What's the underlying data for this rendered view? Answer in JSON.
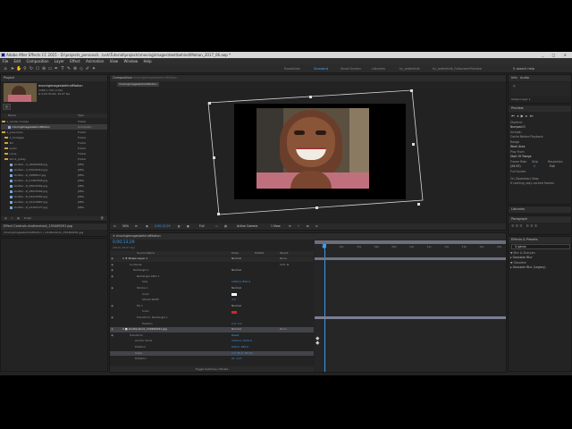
{
  "window": {
    "title": "Adobe After Effects CC 2015 - D:\\projects_personal\\...\\vck\\Tutorial\\projects\\moving\\images\\text\\behind\\Motion_2017_06.aep *",
    "controls": "_ □ ✕"
  },
  "menu": [
    "File",
    "Edit",
    "Composition",
    "Layer",
    "Effect",
    "Animation",
    "View",
    "Window",
    "Help"
  ],
  "workspaces": [
    "Essentials",
    "Standard",
    "Small Screen",
    "Libraries",
    "ky_watchfolk",
    "ky_watchfolk_fullscreenPreview"
  ],
  "active_workspace": "Standard",
  "search": {
    "label": "search help"
  },
  "project": {
    "tab": "Project",
    "comp_name": "movingimagesbehindMotion",
    "comp_info_1": "1280 x 720 (1.00)",
    "comp_info_2": "Δ 0;00;30;00, 29.97 fps",
    "col_name": "Name",
    "col_type": "Type",
    "items": [
      {
        "name": "1_render Comps",
        "type": "Folder",
        "kind": "folder",
        "selected": false
      },
      {
        "name": "movingimagesbehindMotion",
        "type": "Composit...",
        "kind": "comp",
        "selected": true
      },
      {
        "name": "2_precomps",
        "type": "Folder",
        "kind": "folder",
        "selected": false
      },
      {
        "name": "3_footages",
        "type": "Folder",
        "kind": "folder",
        "selected": false
      },
      {
        "name": "3D",
        "type": "Folder",
        "kind": "folder",
        "selected": false
      },
      {
        "name": "audio",
        "type": "Folder",
        "kind": "folder",
        "selected": false
      },
      {
        "name": "noise",
        "type": "Folder",
        "kind": "folder",
        "selected": false
      },
      {
        "name": "stock_pixlay",
        "type": "Folder",
        "kind": "folder",
        "selected": false
      },
      {
        "name": "shutter...4_18989848.jpg",
        "type": "JPEG",
        "kind": "jpg",
        "selected": false
      },
      {
        "name": "shutter...4_55618312.jpg",
        "type": "JPEG",
        "kind": "jpg",
        "selected": false
      },
      {
        "name": "shutter...6_2988812.jpg",
        "type": "JPEG",
        "kind": "jpg",
        "selected": false
      },
      {
        "name": "shutter...8_21987838.jpg",
        "type": "JPEG",
        "kind": "jpg",
        "selected": false
      },
      {
        "name": "shutter...8_28616584.jpg",
        "type": "JPEG",
        "kind": "jpg",
        "selected": false
      },
      {
        "name": "shutter...8_28618584.jpg",
        "type": "JPEG",
        "kind": "jpg",
        "selected": false
      },
      {
        "name": "shutter...8_29216584.jpg",
        "type": "JPEG",
        "kind": "jpg",
        "selected": false
      },
      {
        "name": "shutter...9_24119887.jpg",
        "type": "JPEG",
        "kind": "jpg",
        "selected": false
      },
      {
        "name": "shutter...9_24163127.jpg",
        "type": "JPEG",
        "kind": "jpg",
        "selected": false
      }
    ],
    "bpc": "8 bpc"
  },
  "effect_controls": {
    "tab": "Effect Controls shutterstock_150469291.jpg",
    "subtitle": "movingimagesbehindMotion • shutterstock_150469291.jpg"
  },
  "composition": {
    "tab": "Composition",
    "tab_name": "movingimagesbehindMotion",
    "crumb": "movingimagesbehindMotion",
    "zoom": "50%",
    "timecode": "0;00;13;29",
    "quality": "Full",
    "camera": "Active Camera",
    "view": "1 View"
  },
  "timeline": {
    "tab": "movingimagesbehindMotion",
    "timecode": "0;00;13;29",
    "frame_info": "00419 (29.97 fps)",
    "col_source": "Source Name",
    "col_mode": "Mode",
    "col_trkmat": "TrkMat",
    "col_parent": "Parent",
    "toggle_label": "Toggle Switches / Modes",
    "ruler": [
      "00s",
      "02s",
      "04s",
      "06s",
      "08s",
      "10s",
      "12s",
      "14s",
      "16s",
      "18s",
      "20s"
    ],
    "rows": [
      {
        "text": "1  ★ Shape Layer 1",
        "mode": "Normal",
        "parent": "None",
        "kind": "layer",
        "highlight": false
      },
      {
        "text": "Contents",
        "mode": "",
        "parent": "Add: ⊕",
        "kind": "group",
        "highlight": false
      },
      {
        "text": "Rectangle 1",
        "mode": "Normal",
        "parent": "",
        "kind": "prop",
        "highlight": false
      },
      {
        "text": "Rectangle Path 1",
        "mode": "",
        "parent": "",
        "kind": "prop",
        "highlight": false
      },
      {
        "text": "Size",
        "mode": "",
        "parent": "1904.0, 892.0",
        "kind": "value",
        "highlight": false
      },
      {
        "text": "Stroke 1",
        "mode": "Normal",
        "parent": "",
        "kind": "prop",
        "highlight": false
      },
      {
        "text": "Color",
        "mode": "",
        "parent": "",
        "kind": "swatch-white",
        "highlight": false
      },
      {
        "text": "Stroke Width",
        "mode": "",
        "parent": "4.0",
        "kind": "value",
        "highlight": false
      },
      {
        "text": "Fill 1",
        "mode": "Normal",
        "parent": "",
        "kind": "prop",
        "highlight": false
      },
      {
        "text": "Color",
        "mode": "",
        "parent": "",
        "kind": "swatch-red",
        "highlight": false
      },
      {
        "text": "Transform: Rectangle 1",
        "mode": "",
        "parent": "",
        "kind": "prop",
        "highlight": false
      },
      {
        "text": "Position",
        "mode": "",
        "parent": "0.0, 0.0",
        "kind": "value",
        "highlight": false
      },
      {
        "text": "2  ■ shutterstock_150469291.jpg",
        "mode": "Normal",
        "parent": "None",
        "kind": "layer2",
        "highlight": true
      },
      {
        "text": "Transform",
        "mode": "Reset",
        "parent": "",
        "kind": "group",
        "highlight": false
      },
      {
        "text": "Anchor Point",
        "mode": "",
        "parent": "1024.0, 1024.0",
        "kind": "value",
        "highlight": false
      },
      {
        "text": "Position",
        "mode": "",
        "parent": "640.0, 360.0",
        "kind": "value",
        "highlight": false
      },
      {
        "text": "Scale",
        "mode": "",
        "parent": "⊂⊃ 35.0, 35.0%",
        "kind": "value",
        "highlight": true
      },
      {
        "text": "Rotation",
        "mode": "",
        "parent": "0x -4.0°",
        "kind": "value",
        "highlight": false
      }
    ]
  },
  "info_panel": {
    "tabs": [
      "Info",
      "Audio"
    ],
    "layer_label": "Shape Layer 1"
  },
  "preview": {
    "tab": "Preview",
    "shortcut_label": "Shortcut",
    "shortcut_value": "Numpad 0",
    "include_label": "Include:",
    "cache_label": "Cache Before Playback",
    "range_label": "Range",
    "range_value": "Work Area",
    "play_from_label": "Play From",
    "play_from_value": "Start Of Range",
    "frame_rate_label": "Frame Rate",
    "frame_rate_value": "(29.97)",
    "skip_label": "Skip",
    "skip_value": "0",
    "resolution_label": "Resolution",
    "resolution_value": "Full",
    "fullscreen_label": "Full Screen",
    "on_stop_label": "On (Spacebar) Stop:",
    "on_stop_value": "If caching, play cached frames"
  },
  "libraries": {
    "tab": "Libraries"
  },
  "paragraph": {
    "tab": "Paragraph"
  },
  "effects_presets": {
    "tab": "Effects & Presets",
    "search_value": "gauss",
    "items": [
      "▼ Blur & Sharpen",
      "  ▸ Gaussian Blur",
      "▼ Obsolete",
      "  ▸ Gaussian Blur (Legacy)"
    ]
  },
  "colors": {
    "accent": "#3ea4ff",
    "panel_bg": "#232323",
    "folder": "#d0a33b",
    "fill_red": "#d52525"
  }
}
